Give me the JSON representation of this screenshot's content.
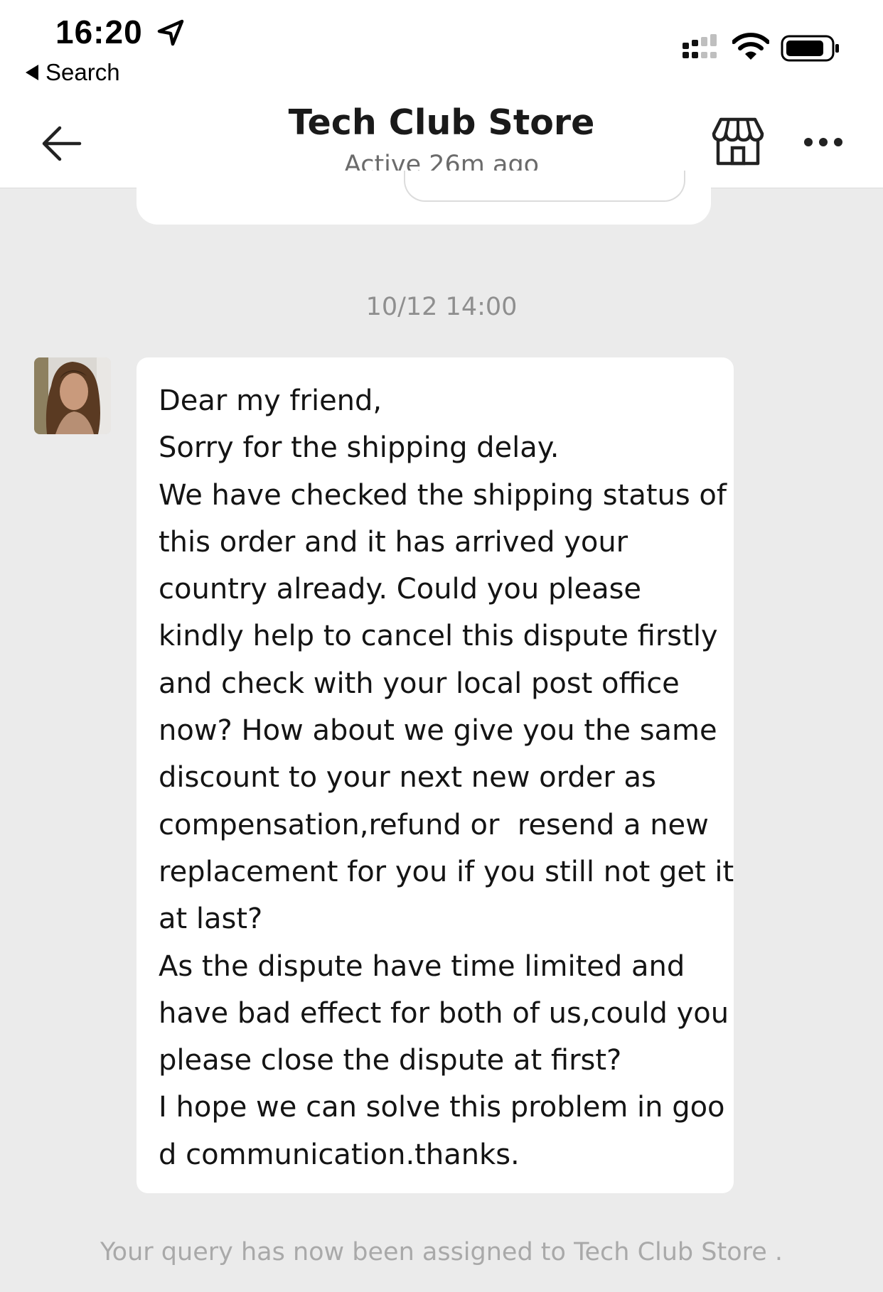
{
  "status_bar": {
    "time": "16:20",
    "back_label": "Search",
    "icons": [
      "location-arrow-icon",
      "cellular-signal-icon",
      "wifi-icon",
      "battery-icon"
    ]
  },
  "header": {
    "title": "Tech Club Store",
    "subtitle": "Active 26m ago",
    "icons": [
      "back-arrow-icon",
      "store-icon",
      "more-icon"
    ]
  },
  "chat": {
    "timestamp": "10/12 14:00",
    "message_lines": [
      "Dear my friend,",
      "Sorry for the shipping delay.",
      "We have checked the shipping status of",
      "this order and it has arrived your",
      "country already. Could you please",
      "kindly help to cancel this dispute firstly",
      "and check with your local post office",
      "now? How about we give you the same",
      "discount to your next new order as",
      "compensation,refund or  resend a new",
      "replacement for you if you still not get it",
      "at last?",
      "As the dispute have time limited and",
      "have bad effect for both of us,could you",
      "please close the dispute at first?",
      "I hope we can solve this problem in goo",
      "d communication.thanks."
    ],
    "system_note": "Your query has now been assigned to Tech Club Store ."
  },
  "colors": {
    "background": "#ebebeb",
    "bubble": "#ffffff",
    "muted_text": "#8f8f8f"
  }
}
